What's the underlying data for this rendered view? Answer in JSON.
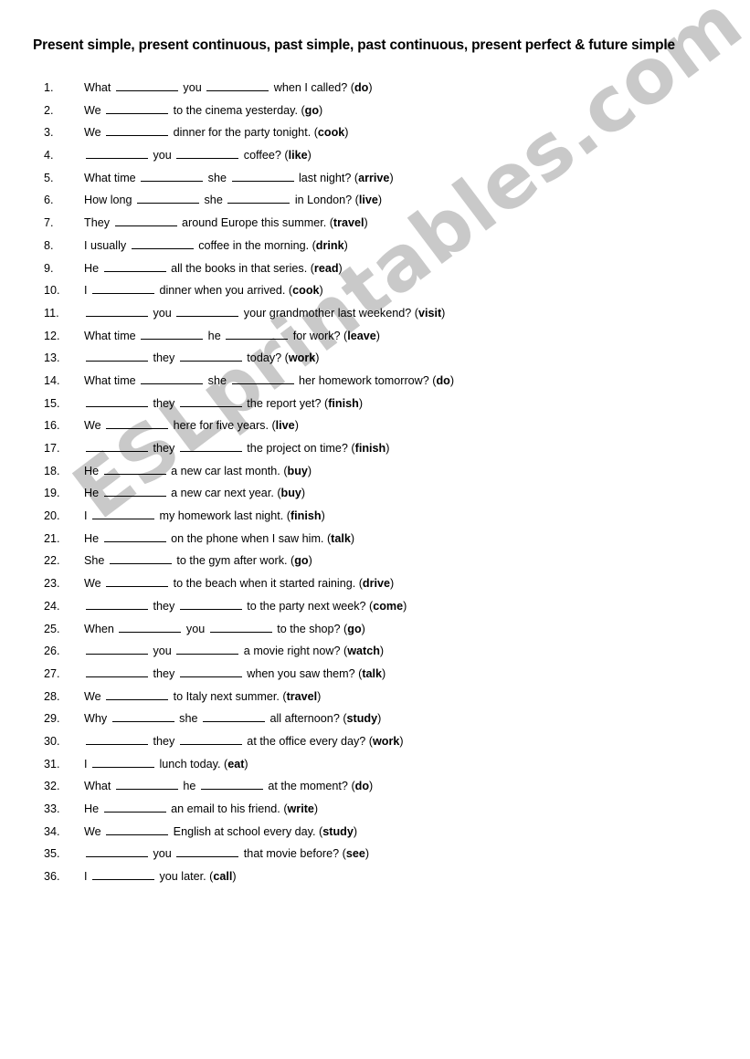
{
  "document": {
    "title": "Present simple, present continuous, past simple, past continuous, present perfect & future simple",
    "watermark": "ESLprintables.com",
    "watermark_color": "#c9c9c9",
    "background_color": "#ffffff",
    "text_color": "#000000",
    "blank_marker": "__________"
  },
  "exercises": [
    {
      "number": "1.",
      "pre": "What ",
      "mid": " you ",
      "post": " when I called? ",
      "verb": "do"
    },
    {
      "number": "2.",
      "pre": "We ",
      "mid": "",
      "post": " to the cinema yesterday. ",
      "verb": "go"
    },
    {
      "number": "3.",
      "pre": "We ",
      "mid": "",
      "post": " dinner for the party tonight. ",
      "verb": "cook"
    },
    {
      "number": "4.",
      "pre": "",
      "mid": " you ",
      "post": " coffee? ",
      "verb": "like"
    },
    {
      "number": "5.",
      "pre": "What time ",
      "mid": " she ",
      "post": " last night? ",
      "verb": "arrive"
    },
    {
      "number": "6.",
      "pre": "How long ",
      "mid": " she ",
      "post": " in London? ",
      "verb": "live"
    },
    {
      "number": "7.",
      "pre": "They ",
      "mid": "",
      "post": " around Europe this summer. ",
      "verb": "travel"
    },
    {
      "number": "8.",
      "pre": "I usually ",
      "mid": "",
      "post": " coffee in the morning. ",
      "verb": "drink"
    },
    {
      "number": "9.",
      "pre": "He ",
      "mid": "",
      "post": " all the books in that series. ",
      "verb": "read"
    },
    {
      "number": "10.",
      "pre": "I ",
      "mid": "",
      "post": " dinner when you arrived. ",
      "verb": "cook"
    },
    {
      "number": "11.",
      "pre": "",
      "mid": " you ",
      "post": " your grandmother last weekend? ",
      "verb": "visit"
    },
    {
      "number": "12.",
      "pre": "What time ",
      "mid": " he ",
      "post": " for work? ",
      "verb": "leave"
    },
    {
      "number": "13.",
      "pre": "",
      "mid": " they ",
      "post": " today? ",
      "verb": "work"
    },
    {
      "number": "14.",
      "pre": "What time ",
      "mid": " she ",
      "post": " her homework tomorrow? ",
      "verb": "do"
    },
    {
      "number": "15.",
      "pre": "",
      "mid": " they ",
      "post": " the report yet? ",
      "verb": "finish"
    },
    {
      "number": "16.",
      "pre": "We ",
      "mid": "",
      "post": " here for five years. ",
      "verb": "live"
    },
    {
      "number": "17.",
      "pre": "",
      "mid": " they ",
      "post": " the project on time? ",
      "verb": "finish"
    },
    {
      "number": "18.",
      "pre": "He ",
      "mid": "",
      "post": " a new car last month. ",
      "verb": "buy"
    },
    {
      "number": "19.",
      "pre": "He ",
      "mid": "",
      "post": " a new car next year. ",
      "verb": "buy"
    },
    {
      "number": "20.",
      "pre": "I ",
      "mid": "",
      "post": " my homework last night. ",
      "verb": "finish"
    },
    {
      "number": "21.",
      "pre": "He ",
      "mid": "",
      "post": " on the phone when I saw him. ",
      "verb": "talk"
    },
    {
      "number": "22.",
      "pre": "She ",
      "mid": "",
      "post": " to the gym after work. ",
      "verb": "go"
    },
    {
      "number": "23.",
      "pre": "We ",
      "mid": "",
      "post": " to the beach when it started raining. ",
      "verb": "drive"
    },
    {
      "number": "24.",
      "pre": "",
      "mid": " they ",
      "post": " to the party next week? ",
      "verb": "come"
    },
    {
      "number": "25.",
      "pre": "When ",
      "mid": " you ",
      "post": " to the shop? ",
      "verb": "go"
    },
    {
      "number": "26.",
      "pre": "",
      "mid": " you ",
      "post": " a movie right now? ",
      "verb": "watch"
    },
    {
      "number": "27.",
      "pre": "",
      "mid": " they ",
      "post": " when you saw them? ",
      "verb": "talk"
    },
    {
      "number": "28.",
      "pre": "We ",
      "mid": "",
      "post": " to Italy next summer. ",
      "verb": "travel"
    },
    {
      "number": "29.",
      "pre": "Why ",
      "mid": " she ",
      "post": " all afternoon? ",
      "verb": "study"
    },
    {
      "number": "30.",
      "pre": "",
      "mid": " they ",
      "post": " at the office every day? ",
      "verb": "work"
    },
    {
      "number": "31.",
      "pre": "I ",
      "mid": "",
      "post": " lunch today. ",
      "verb": "eat"
    },
    {
      "number": "32.",
      "pre": "What ",
      "mid": " he ",
      "post": " at the moment? ",
      "verb": "do"
    },
    {
      "number": "33.",
      "pre": "He ",
      "mid": "",
      "post": " an email to his friend. ",
      "verb": "write"
    },
    {
      "number": "34.",
      "pre": "We ",
      "mid": "",
      "post": " English at school every day. ",
      "verb": "study"
    },
    {
      "number": "35.",
      "pre": "",
      "mid": " you ",
      "post": " that movie before? ",
      "verb": "see"
    },
    {
      "number": "36.",
      "pre": "I ",
      "mid": "",
      "post": " you later. ",
      "verb": "call"
    }
  ]
}
